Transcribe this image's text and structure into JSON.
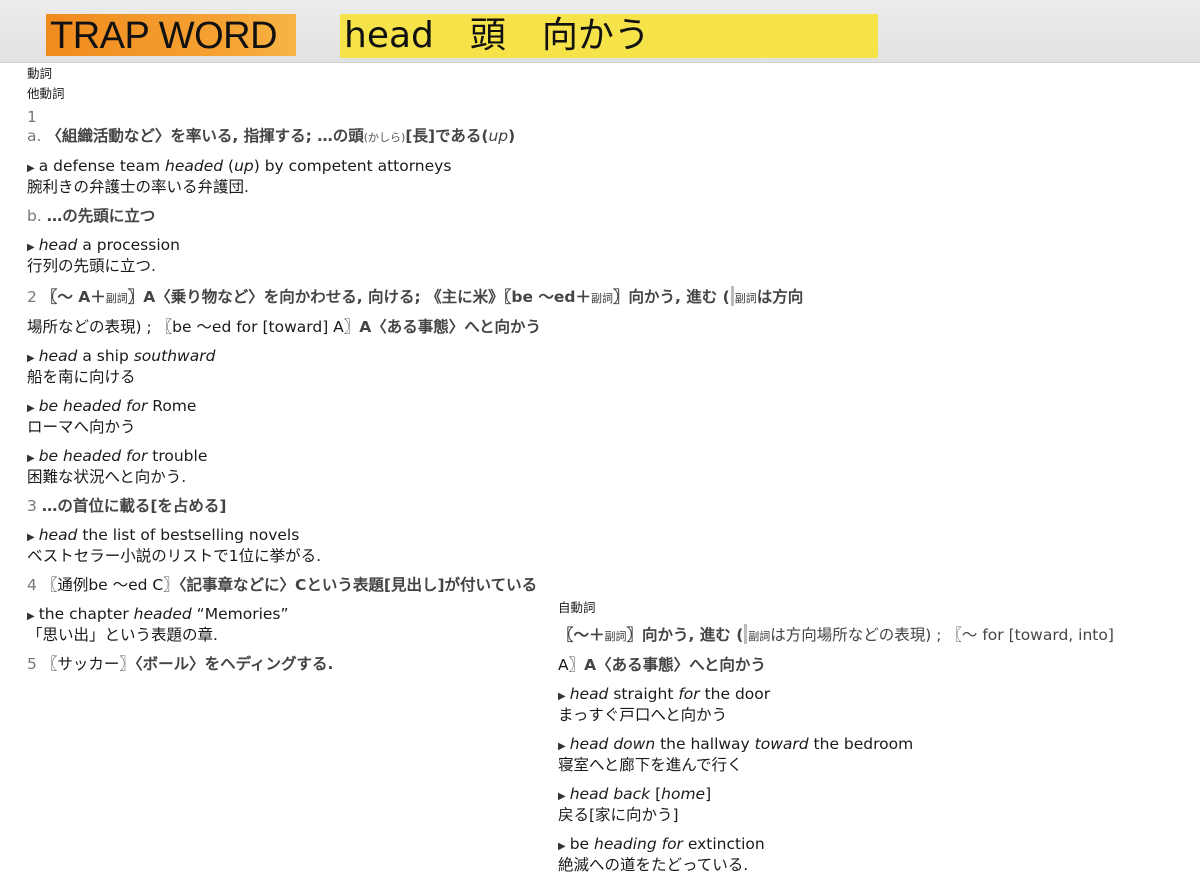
{
  "header": {
    "trap_label": "TRAP WORD",
    "word_line": "head　頭　向かう"
  },
  "left": {
    "pos1": "動詞",
    "pos2": "他動詞",
    "s1_num": "1",
    "s1a_num": "a.",
    "s1a_def_a": "〈組織活動など〉を率いる, 指揮する; …の頭",
    "s1a_reading": "(かしら)",
    "s1a_def_b": "[長]である(",
    "s1a_up": "up",
    "s1a_close": ")",
    "ex1_pre": "a defense team ",
    "ex1_it1": "headed",
    "ex1_mid1": " (",
    "ex1_it2": "up",
    "ex1_post": ") by competent attorneys",
    "ex1_jp": "腕利きの弁護士の率いる弁護団.",
    "s1b_num": "b.",
    "s1b_def": "…の先頭に立つ",
    "ex2_it": "head",
    "ex2_post": " a procession",
    "ex2_jp": "行列の先頭に立つ.",
    "s2_num": "2",
    "s2_l1_a": "〖〜 A＋",
    "s2_l1_adv": "副詞",
    "s2_l1_b": "〗A〈乗り物など〉を向かわせる, 向ける; 《主に米》〖be 〜ed＋",
    "s2_l1_adv2": "副詞",
    "s2_l1_c": "〗向かう, 進む (",
    "s2_l1_adv3": "副詞",
    "s2_l1_d": "は方向",
    "s2_l2_a": "場所などの表現) ; 〖be 〜ed for [toward] A〗",
    "s2_l2_b": "A〈ある事態〉へと向かう",
    "ex3_it1": "head",
    "ex3_mid": " a ship ",
    "ex3_it2": "southward",
    "ex3_jp": "船を南に向ける",
    "ex4_it": "be headed for",
    "ex4_post": " Rome",
    "ex4_jp": "ローマへ向かう",
    "ex5_it": "be headed for",
    "ex5_post": " trouble",
    "ex5_jp": "困難な状況へと向かう.",
    "s3_num": "3",
    "s3_def": "…の首位に載る[を占める]",
    "ex6_it": "head",
    "ex6_post": " the list of bestselling novels",
    "ex6_jp": "ベストセラー小説のリストで1位に挙がる.",
    "s4_num": "4",
    "s4_a": "〖通例be 〜ed C〗",
    "s4_b": "〈記事章などに〉Cという表題[見出し]が付いている",
    "ex7_pre": "the chapter ",
    "ex7_it": "headed",
    "ex7_post": " “Memories”",
    "ex7_jp": "「思い出」という表題の章.",
    "s5_num": "5",
    "s5_a": "〖サッカー〗",
    "s5_b": "〈ボール〉をヘディングする."
  },
  "right": {
    "pos": "自動詞",
    "d_l1_a": "〖〜＋",
    "d_l1_adv": "副詞",
    "d_l1_b": "〗向かう, 進む (",
    "d_l1_adv2": "副詞",
    "d_l1_c": "は方向場所などの表現) ; 〖〜 for [toward, into]",
    "d_l2_a": "A〗",
    "d_l2_b": "A〈ある事態〉へと向かう",
    "ex1_it1": "head",
    "ex1_mid": " straight ",
    "ex1_it2": "for",
    "ex1_post": " the door",
    "ex1_jp": "まっすぐ戸口へと向かう",
    "ex2_it1": "head down",
    "ex2_mid": " the hallway ",
    "ex2_it2": "toward",
    "ex2_post": " the bedroom",
    "ex2_jp": "寝室へと廊下を進んで行く",
    "ex3_it1": "head back",
    "ex3_mid": " [",
    "ex3_it2": "home",
    "ex3_post": "]",
    "ex3_jp": "戻る[家に向かう]",
    "ex4_pre": "be ",
    "ex4_it": "heading for",
    "ex4_post": " extinction",
    "ex4_jp": "絶滅への道をたどっている."
  },
  "icons": {
    "example_marker": "triangle-right-icon",
    "text_cursor": "caret-icon"
  },
  "colors": {
    "trap_bg": "#f39a2a",
    "word_bg": "#f6e34a",
    "header_bg": "#e6e6e6"
  }
}
